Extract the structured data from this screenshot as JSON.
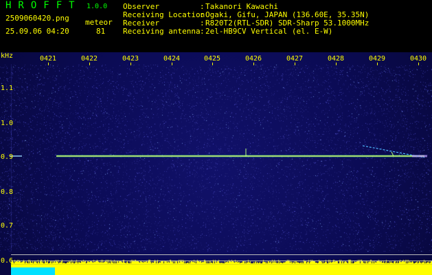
{
  "header": {
    "app_name": "HROFFT",
    "version": "1.0.0",
    "file_name": "2509060420.png",
    "meteor_label": "meteor",
    "timestamp": "25.09.06 04:20",
    "meteor_count": "81",
    "info": [
      {
        "label": "Observer",
        "value": "Takanori Kawachi"
      },
      {
        "label": "Receiving Location",
        "value": "Ogaki, Gifu, JAPAN (136.60E, 35.35N)"
      },
      {
        "label": "Receiver",
        "value": "R820T2(RTL-SDR) SDR-Sharp 53.1000MHz"
      },
      {
        "label": "Receiving antenna",
        "value": "2el-HB9CV Vertical (el. E-W)"
      }
    ]
  },
  "spectrogram": {
    "y_unit": "kHz",
    "y_ticks": [
      "1.1",
      "1.0",
      "0.9",
      "0.8",
      "0.7",
      "0.6"
    ],
    "x_ticks": [
      "0421",
      "0422",
      "0423",
      "0424",
      "0425",
      "0426",
      "0427",
      "0428",
      "0429",
      "0430"
    ],
    "colors": {
      "background": "#0b0b55",
      "signal": "#ffff66",
      "noise": "#3a3aa0",
      "labels": "#ffff00"
    }
  }
}
